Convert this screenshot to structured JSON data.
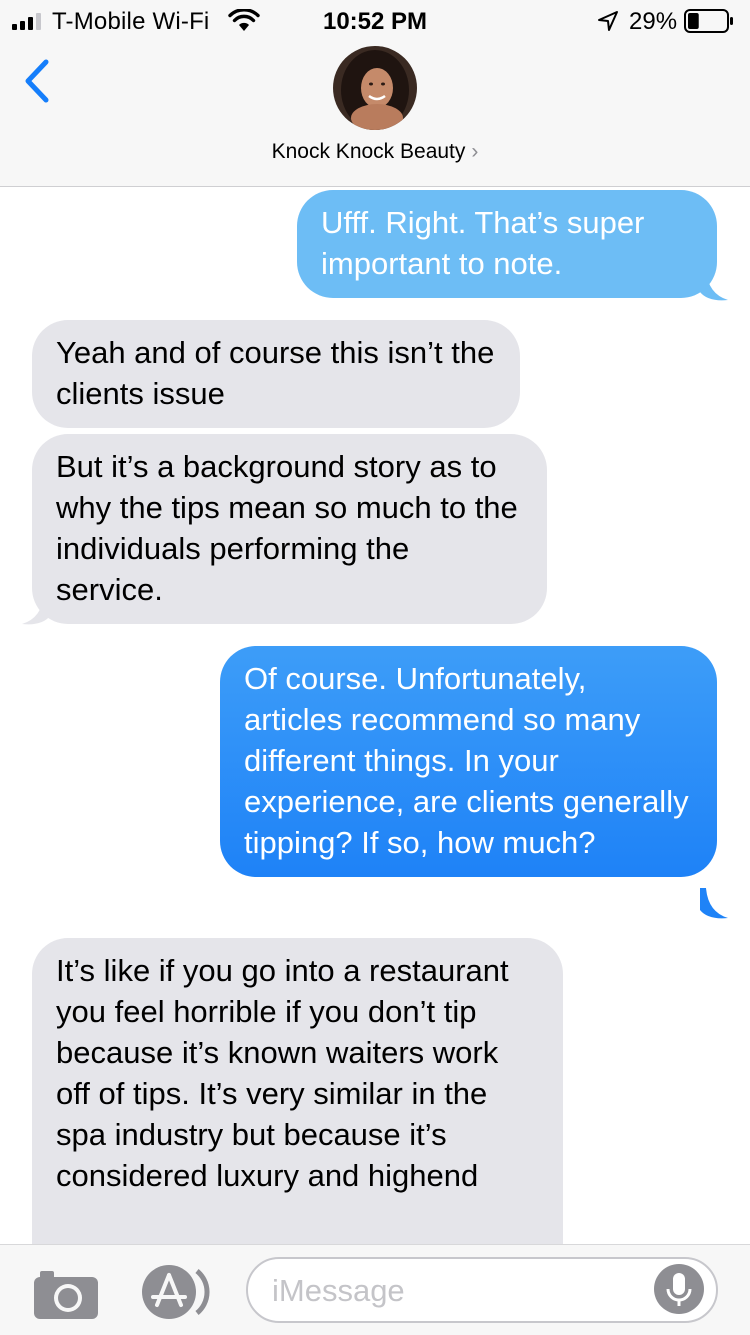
{
  "status_bar": {
    "carrier": "T-Mobile Wi-Fi",
    "time": "10:52 PM",
    "battery_percent": "29%",
    "battery_level": 0.29,
    "icons": [
      "signal-icon",
      "wifi-icon",
      "location-icon",
      "battery-icon"
    ]
  },
  "header": {
    "back_icon": "chevron-left-icon",
    "contact_name": "Knock Knock Beauty",
    "contact_chevron": "›"
  },
  "messages": [
    {
      "direction": "sent",
      "text": "Ufff. Right. That’s super important to note."
    },
    {
      "direction": "received",
      "text": "Yeah and of course this isn’t the clients issue"
    },
    {
      "direction": "received",
      "text": "But it’s a background story as to why the tips mean so much to the individuals performing the service."
    },
    {
      "direction": "sent",
      "text": "Of course. Unfortunately, articles recommend so many different things. In your experience, are clients generally tipping? If so, how much?"
    },
    {
      "direction": "received",
      "text": "It’s like if you go into a restaurant you feel horrible if you don’t tip because it’s known waiters work off of tips. It’s very similar in the spa industry but because it’s considered luxury and highend"
    }
  ],
  "input_bar": {
    "placeholder": "iMessage",
    "icons": [
      "camera-icon",
      "app-store-icon",
      "microphone-icon"
    ]
  },
  "colors": {
    "sent_sms_bubble": "#6dbdf5",
    "sent_imessage_bubble": "#1e82f7",
    "received_bubble": "#e5e5ea",
    "accent": "#157efb"
  }
}
